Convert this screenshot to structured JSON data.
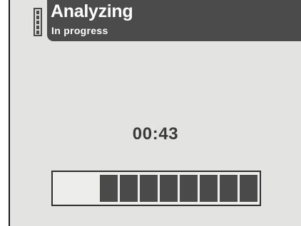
{
  "header": {
    "title": "Analyzing",
    "subtitle": "In progress"
  },
  "timer": {
    "value": "00:43"
  },
  "progress": {
    "filled_segments": 8,
    "total_segments": 10
  },
  "icons": {
    "status": "battery-icon"
  },
  "colors": {
    "header_bg": "#4b4b4b",
    "screen_bg": "#e3e3e1",
    "segment_fill": "#4a4a4a"
  }
}
